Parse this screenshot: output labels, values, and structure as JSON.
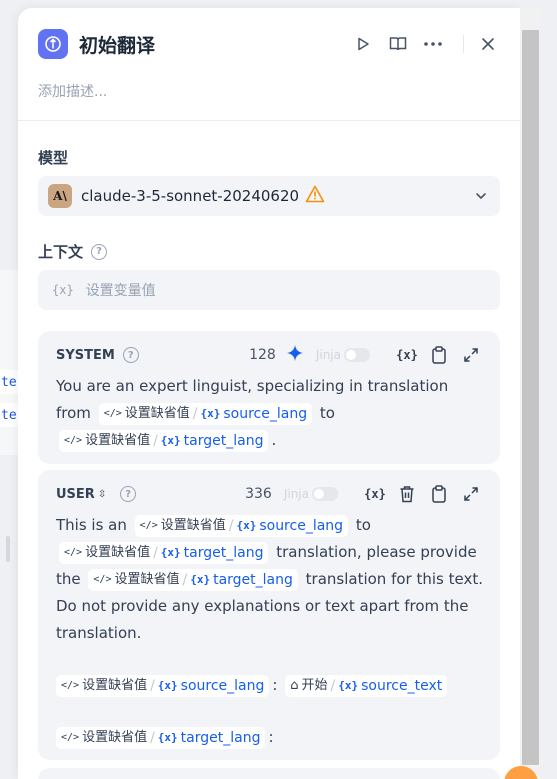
{
  "canvas": {
    "chip_text": "te"
  },
  "header": {
    "title": "初始翻译",
    "description_placeholder": "添加描述..."
  },
  "model": {
    "label": "模型",
    "value": "claude-3-5-sonnet-20240620"
  },
  "context": {
    "label": "上下文",
    "placeholder": "设置变量值"
  },
  "var_default": "设置缺省值",
  "start_node": "开始",
  "system": {
    "role": "SYSTEM",
    "count": "128",
    "jinja": "Jinja",
    "text1": "You are an expert linguist, specializing in translation from",
    "text2": "to",
    "text3": ".",
    "var_source": "source_lang",
    "var_target": "target_lang"
  },
  "user": {
    "role": "USER",
    "count": "336",
    "jinja": "Jinja",
    "t1": "This is an",
    "t2": "to",
    "t3": "translation, please provide the",
    "t4": "translation for this text. Do not provide any explanations or text apart from the translation.",
    "colon": ":",
    "var_source_lang": "source_lang",
    "var_target_lang": "target_lang",
    "var_source_text": "source_text"
  }
}
